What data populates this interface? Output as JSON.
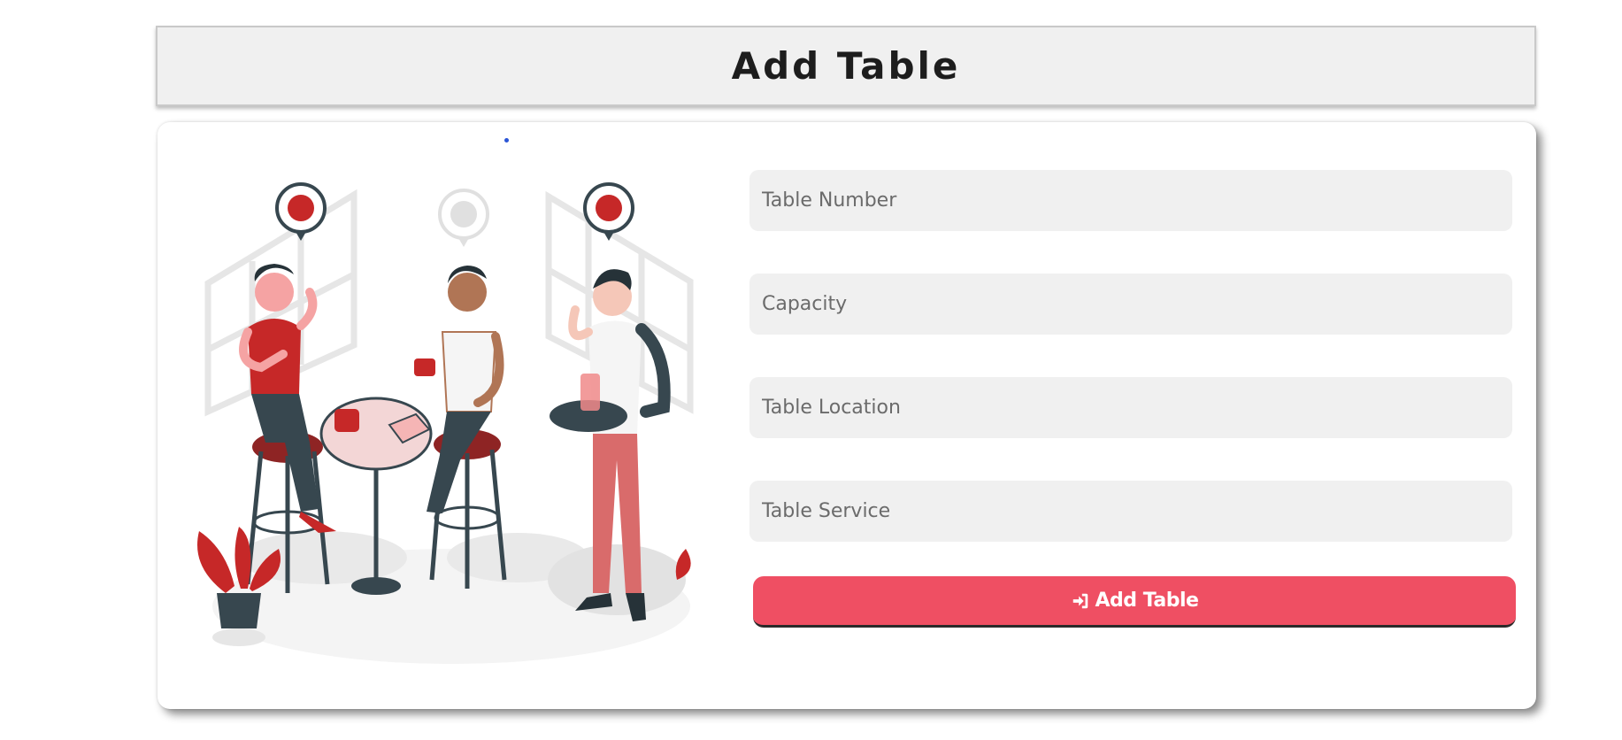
{
  "header": {
    "title": "Add Table"
  },
  "form": {
    "fields": [
      {
        "placeholder": "Table Number",
        "value": ""
      },
      {
        "placeholder": "Capacity",
        "value": ""
      },
      {
        "placeholder": "Table Location",
        "value": ""
      },
      {
        "placeholder": "Table Service",
        "value": ""
      }
    ],
    "submit_label": "Add Table",
    "submit_icon": "sign-in-icon"
  },
  "illustration": {
    "name": "cafe-customers-illustration"
  },
  "colors": {
    "accent": "#ef4f63",
    "field_bg": "#f0f0f0",
    "header_bg": "#f0f0f0"
  }
}
